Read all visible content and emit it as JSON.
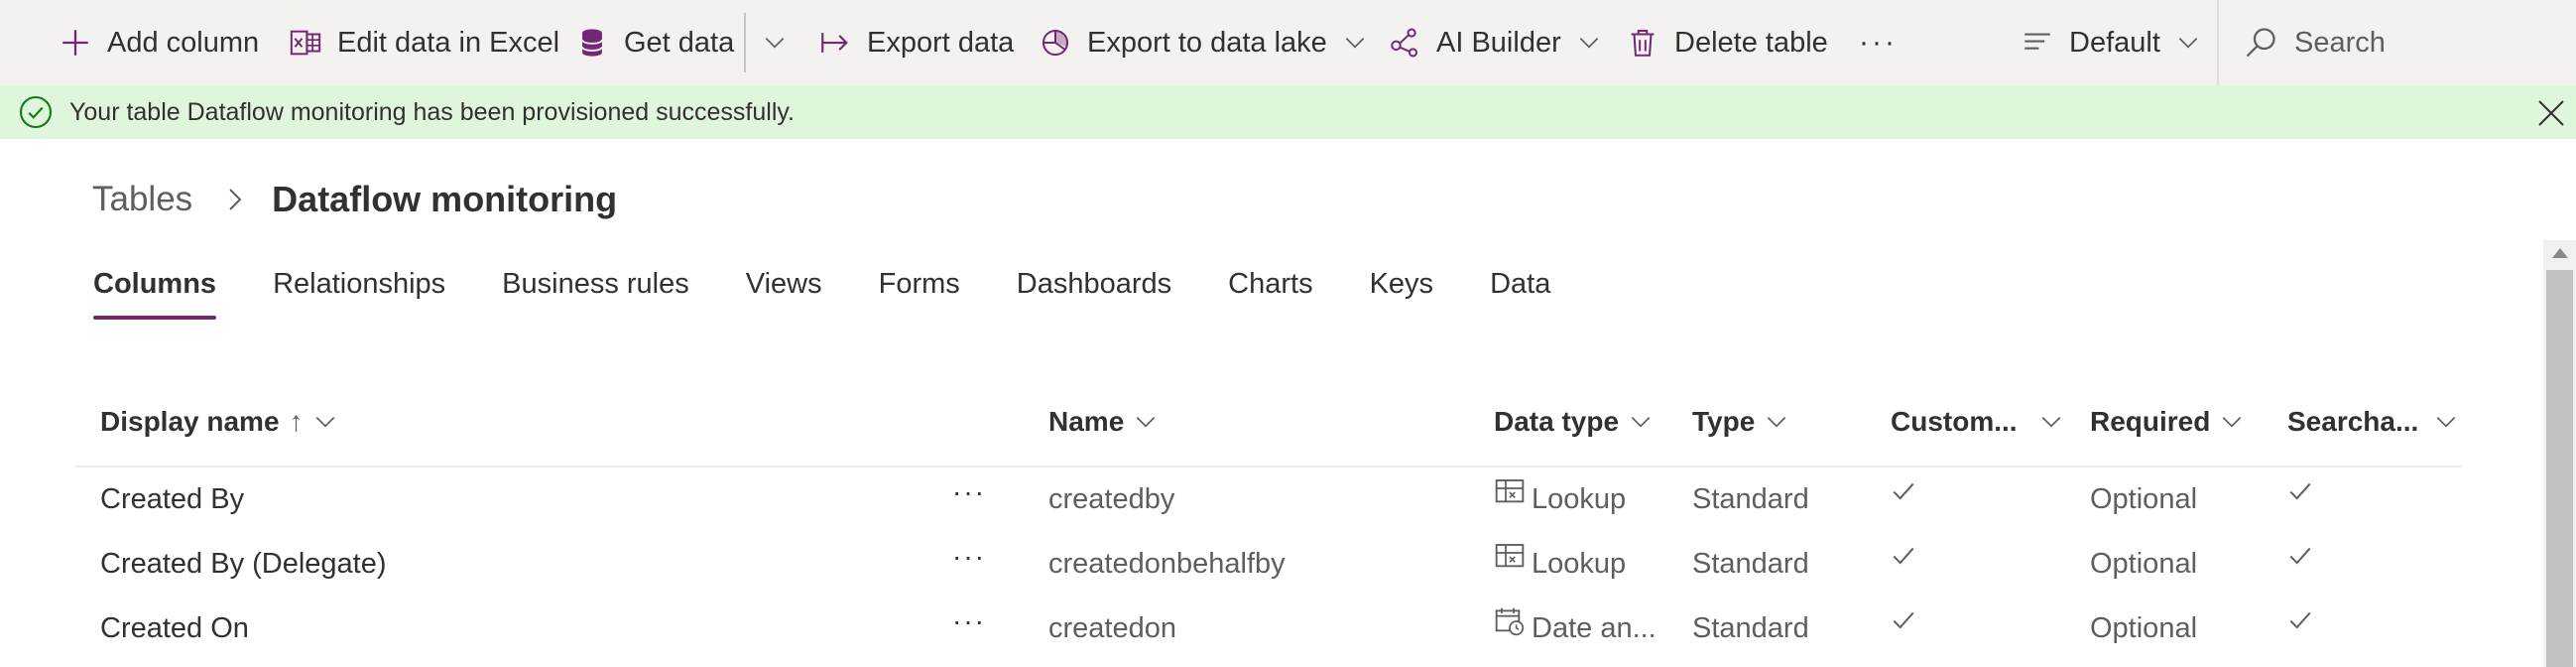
{
  "commandbar": {
    "add_column": "Add column",
    "edit_excel": "Edit data in Excel",
    "get_data": "Get data",
    "export_data": "Export data",
    "export_lake": "Export to data lake",
    "ai_builder": "AI Builder",
    "delete_table": "Delete table",
    "more": "···",
    "view": "Default",
    "search_placeholder": "Search"
  },
  "message": {
    "text": "Your table Dataflow monitoring has been provisioned successfully."
  },
  "breadcrumb": {
    "parent": "Tables",
    "current": "Dataflow monitoring"
  },
  "tabs": [
    {
      "label": "Columns",
      "active": true
    },
    {
      "label": "Relationships"
    },
    {
      "label": "Business rules"
    },
    {
      "label": "Views"
    },
    {
      "label": "Forms"
    },
    {
      "label": "Dashboards"
    },
    {
      "label": "Charts"
    },
    {
      "label": "Keys"
    },
    {
      "label": "Data"
    }
  ],
  "grid": {
    "columns": {
      "display_name": "Display name",
      "sort_arrow": "↑",
      "name": "Name",
      "data_type": "Data type",
      "type": "Type",
      "customizable": "Custom...",
      "required": "Required",
      "searchable": "Searcha..."
    },
    "rows": [
      {
        "display_name": "Created By",
        "more": "···",
        "name": "createdby",
        "data_type": "Lookup",
        "data_type_icon": "lookup-icon",
        "type": "Standard",
        "customizable": true,
        "required": "Optional",
        "searchable": true
      },
      {
        "display_name": "Created By (Delegate)",
        "more": "···",
        "name": "createdonbehalfby",
        "data_type": "Lookup",
        "data_type_icon": "lookup-icon",
        "type": "Standard",
        "customizable": true,
        "required": "Optional",
        "searchable": true
      },
      {
        "display_name": "Created On",
        "more": "···",
        "name": "createdon",
        "data_type": "Date an...",
        "data_type_icon": "date-time-icon",
        "type": "Standard",
        "customizable": true,
        "required": "Optional",
        "searchable": true
      }
    ]
  },
  "colors": {
    "accent": "#742774",
    "success_bg": "#dff6dd",
    "success_icon": "#107c10",
    "commandbar_bg": "#f3f2f1"
  }
}
